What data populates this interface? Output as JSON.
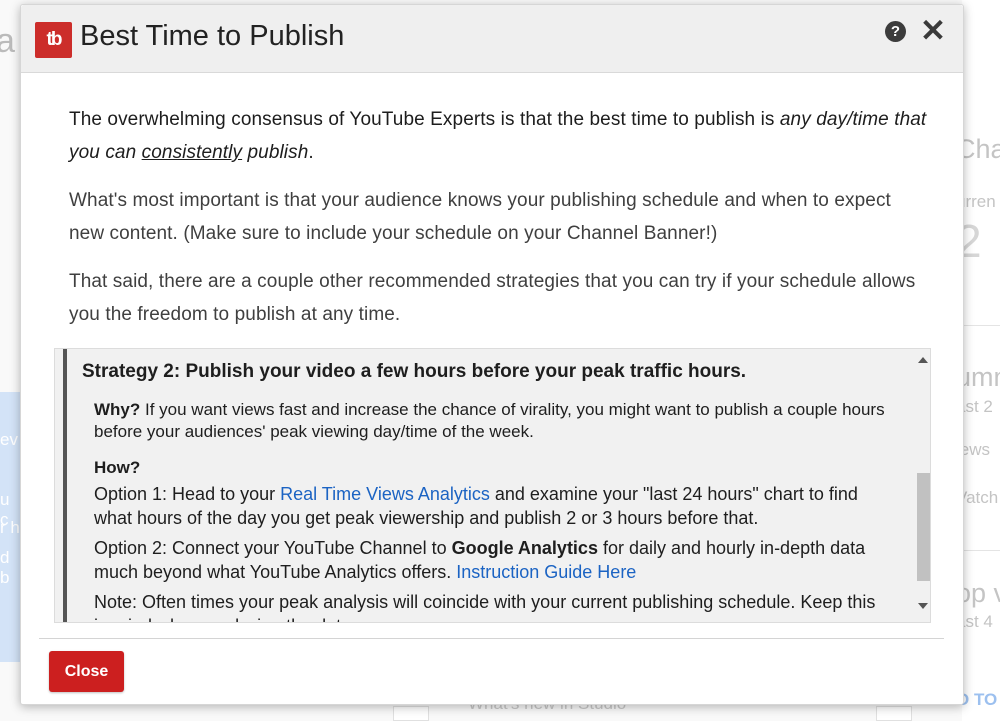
{
  "background": {
    "left_fragment": "a",
    "left_card_lines": [
      "ev",
      "u c",
      "r h",
      "d b"
    ],
    "right_fragments": [
      "Char",
      "urren",
      "2",
      "umm",
      "ast 2",
      "iews",
      "Vatch",
      "op v",
      "ast 4",
      "O TO"
    ],
    "bottom_fragment": "What's new in Studio"
  },
  "modal": {
    "logo_text": "tb",
    "title": "Best Time to Publish",
    "help_icon_glyph": "?",
    "close_icon_glyph": "✕",
    "intro": {
      "part1": "The overwhelming consensus of YouTube Experts is that the best time to publish is ",
      "emph": "any day/time that you can",
      "space": " ",
      "underline": "consistently",
      "emph2": " publish",
      "end": "."
    },
    "para2": "What's most important is that your audience knows your publishing schedule and when to expect new content. (Make sure to include your schedule on your Channel Banner!)",
    "para3": "That said, there are a couple other recommended strategies that you can try if your schedule allows you the freedom to publish at any time.",
    "strategy": {
      "heading": "Strategy 2: Publish your video a few hours before your peak traffic hours.",
      "why_label": "Why?",
      "why_text": " If you want views fast and increase the chance of virality, you might want to publish a couple hours before your audiences' peak viewing day/time of the week.",
      "how_label": "How?",
      "option1_prefix": "Option 1: Head to your ",
      "option1_link": "Real Time Views Analytics",
      "option1_suffix": " and examine your \"last 24 hours\" chart to find what hours of the day you get peak viewership and publish 2 or 3 hours before that.",
      "option2_prefix": "Option 2: Connect your YouTube Channel to ",
      "option2_bold": "Google Analytics",
      "option2_mid": " for daily and hourly in-depth data much beyond what YouTube Analytics offers. ",
      "option2_link": "Instruction Guide Here",
      "note": "Note: Often times your peak analysis will coincide with your current publishing schedule. Keep this in mind when analyzing the data."
    },
    "close_button": "Close"
  },
  "colors": {
    "brand_red": "#cc2d2a",
    "link_blue": "#1b63c3",
    "close_button_red": "#cc1f1f"
  }
}
